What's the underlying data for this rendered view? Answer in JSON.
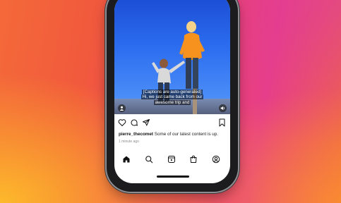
{
  "video": {
    "caption_line1": "[Captions are auto-generated]",
    "caption_line2": "Hi, we just came back from our",
    "caption_line3": "awesome trip and"
  },
  "post": {
    "username": "pierre_thecomet",
    "caption": "Some of our latest content is up.",
    "time": "1 minute ago"
  },
  "actions": [
    "heart-icon",
    "comment-icon",
    "share-icon",
    "save-icon"
  ],
  "nav": [
    "home-icon",
    "search-icon",
    "reels-icon",
    "shop-icon",
    "profile-icon"
  ],
  "colors": {
    "accent": "#f15a3c",
    "text": "#111111"
  }
}
